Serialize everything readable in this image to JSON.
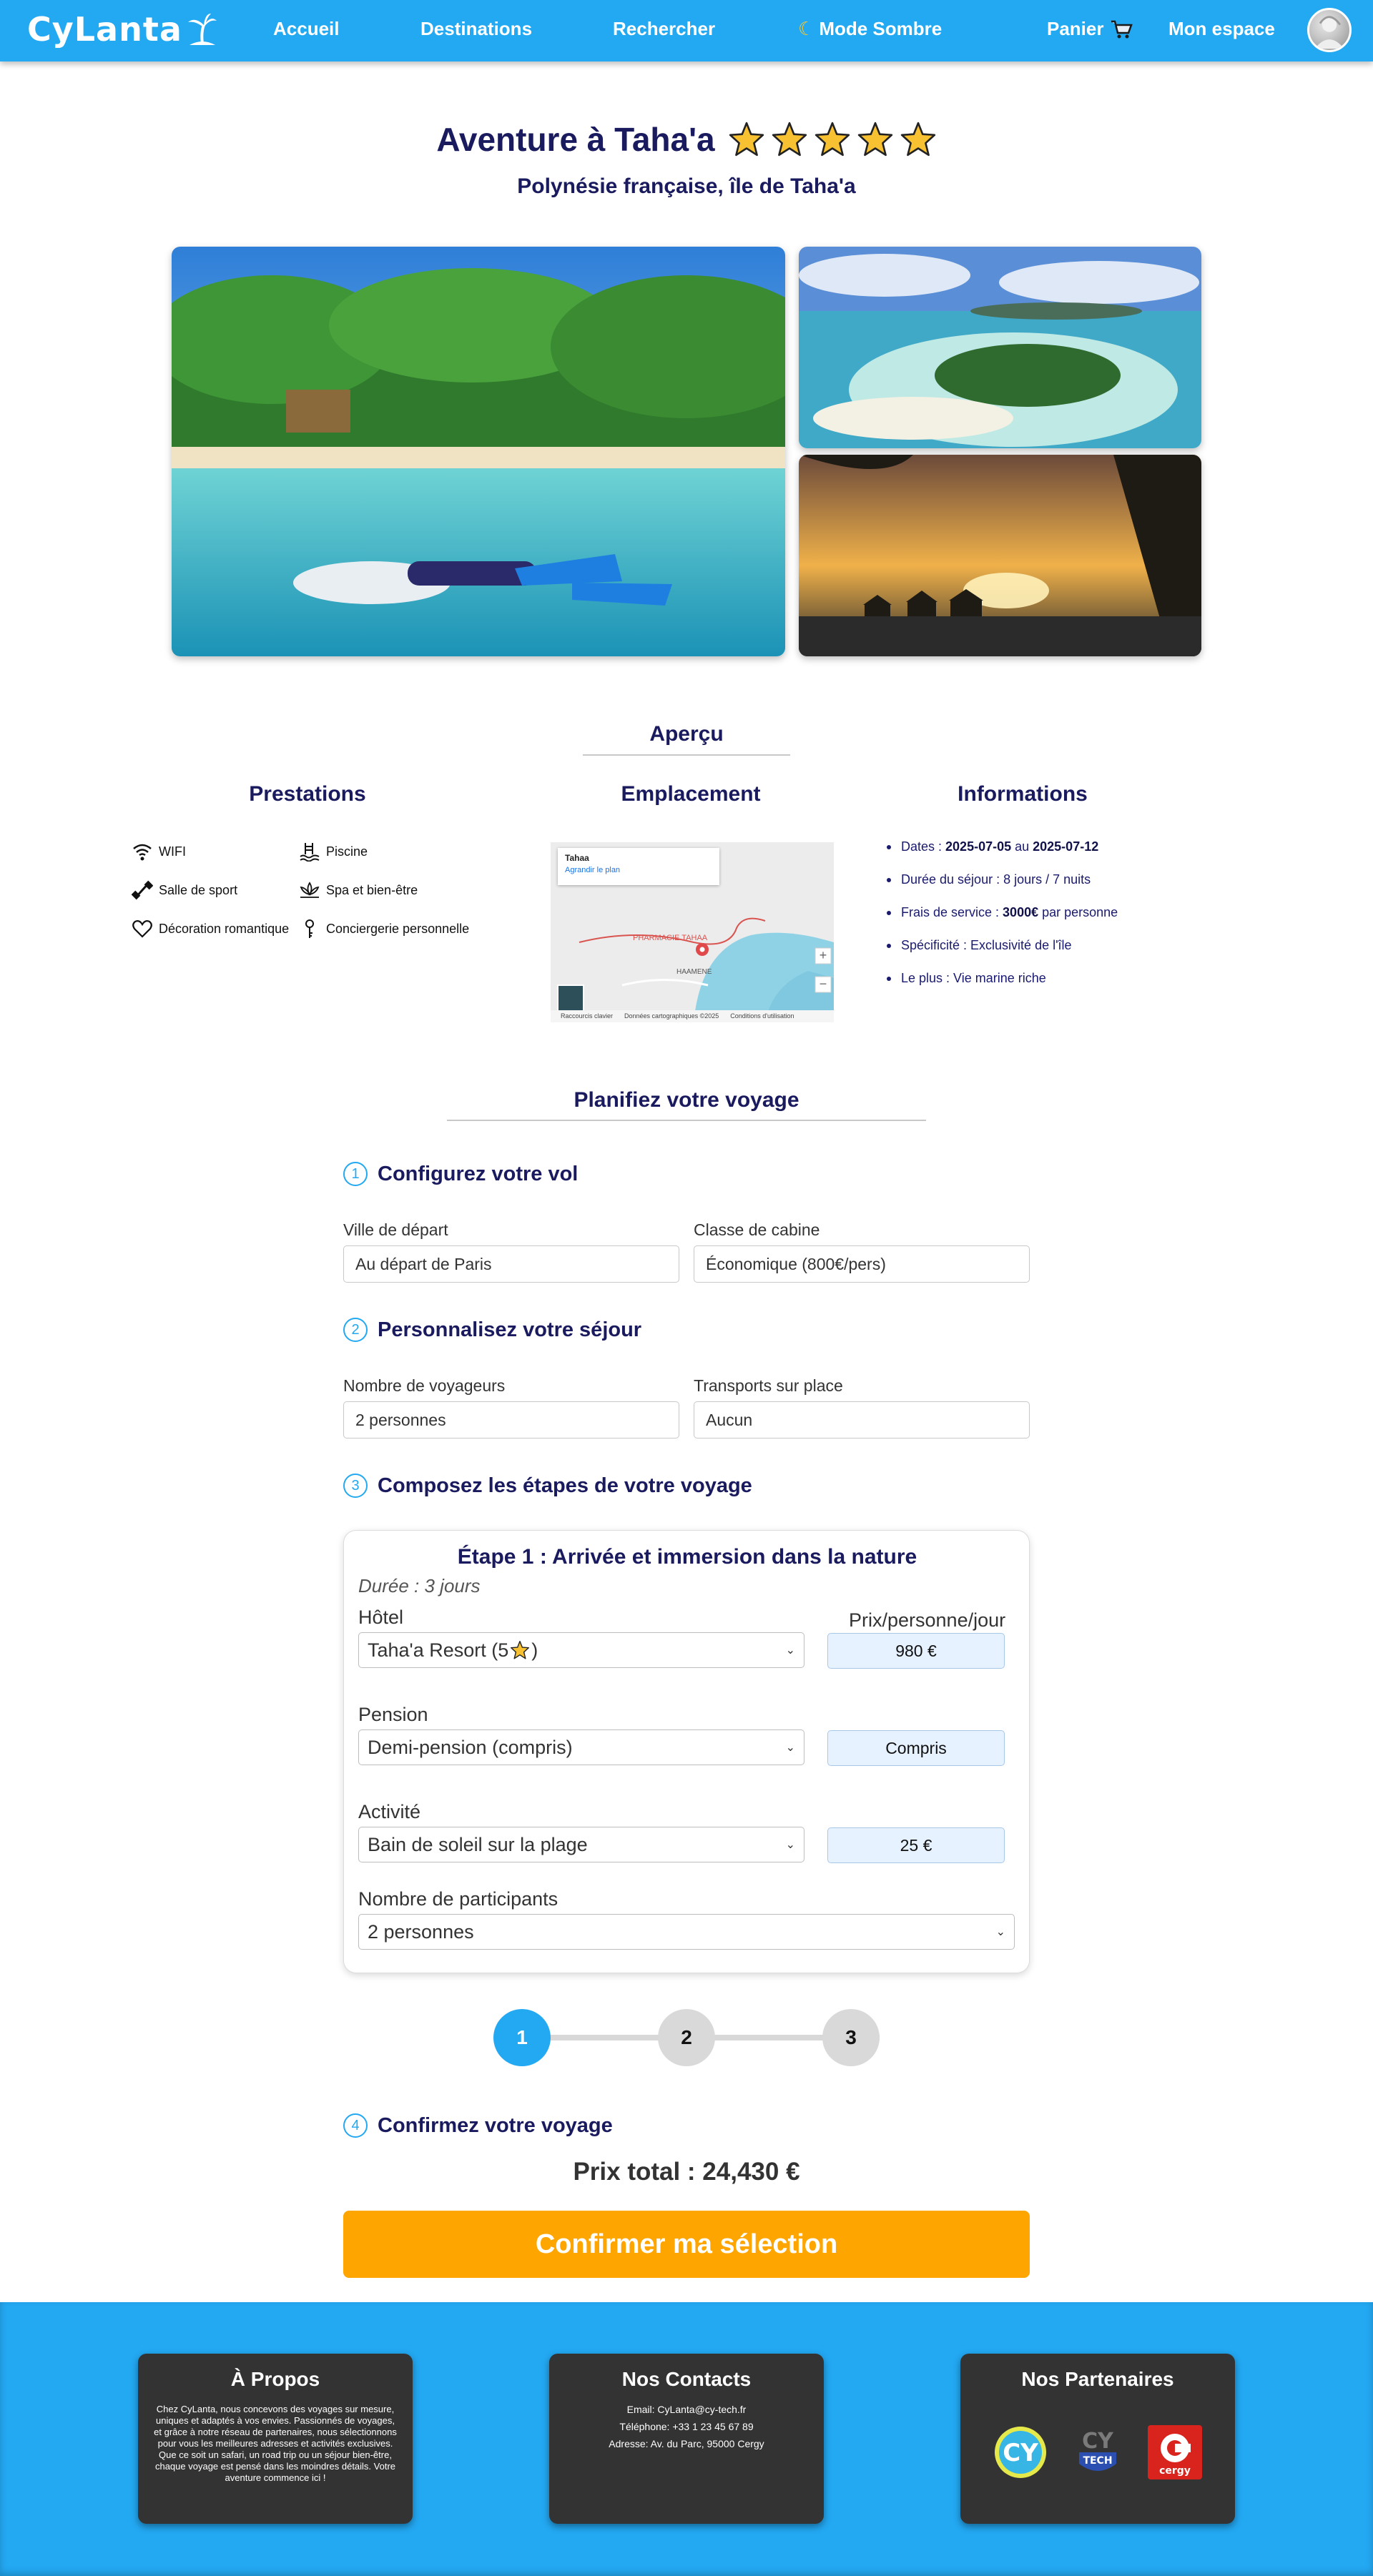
{
  "nav": {
    "brand": "CyLanta",
    "links": [
      "Accueil",
      "Destinations",
      "Rechercher"
    ],
    "dark_mode": "Mode Sombre",
    "cart": "Panier",
    "account": "Mon espace"
  },
  "hero": {
    "title": "Aventure à Taha'a",
    "rating": 5,
    "subtitle": "Polynésie française, île de Taha'a"
  },
  "overview": {
    "heading": "Aperçu",
    "prestations": {
      "heading": "Prestations",
      "items": [
        "WIFI",
        "Piscine",
        "Salle de sport",
        "Spa et bien-être",
        "Décoration romantique",
        "Conciergerie personnelle"
      ]
    },
    "emplacement": {
      "heading": "Emplacement",
      "map_place": "Tahaa",
      "map_link": "Agrandir le plan",
      "map_label1": "PHARMACIE TAHAA",
      "map_label2": "HAAMENE",
      "map_footer": [
        "Raccourcis clavier",
        "Données cartographiques ©2025",
        "Conditions d'utilisation"
      ]
    },
    "informations": {
      "heading": "Informations",
      "dates_label": "Dates : ",
      "date_start": "2025-07-05",
      "date_sep": " au ",
      "date_end": "2025-07-12",
      "duration": "Durée du séjour : 8 jours / 7 nuits",
      "fees_label": "Frais de service : ",
      "fees_value": "3000€",
      "fees_suffix": " par personne",
      "specificity": "Spécificité : Exclusivité de l'île",
      "plus": "Le plus : Vie marine riche"
    }
  },
  "plan": {
    "heading": "Planifiez votre voyage",
    "step1": {
      "num": "1",
      "title": "Configurez votre vol",
      "departure_label": "Ville de départ",
      "departure_value": "Au départ de Paris",
      "cabin_label": "Classe de cabine",
      "cabin_value": "Économique (800€/pers)"
    },
    "step2": {
      "num": "2",
      "title": "Personnalisez votre séjour",
      "travelers_label": "Nombre de voyageurs",
      "travelers_value": "2 personnes",
      "transport_label": "Transports sur place",
      "transport_value": "Aucun"
    },
    "step3": {
      "num": "3",
      "title": "Composez les étapes de votre voyage",
      "card": {
        "title": "Étape 1 : Arrivée et immersion dans la nature",
        "duration": "Durée : 3 jours",
        "hotel_label": "Hôtel",
        "price_header": "Prix/personne/jour",
        "hotel_value": "Taha'a Resort (5",
        "hotel_suffix": ")",
        "hotel_price": "980 €",
        "pension_label": "Pension",
        "pension_value": "Demi-pension (compris)",
        "pension_price": "Compris",
        "activity_label": "Activité",
        "activity_value": "Bain de soleil sur la plage",
        "activity_price": "25 €",
        "participants_label": "Nombre de participants",
        "participants_value": "2 personnes"
      },
      "stepper": [
        "1",
        "2",
        "3"
      ],
      "active_step": 1
    },
    "step4": {
      "num": "4",
      "title": "Confirmez votre voyage",
      "total": "Prix total : 24,430 €",
      "confirm": "Confirmer ma sélection"
    }
  },
  "footer": {
    "about_title": "À Propos",
    "about_text": "Chez CyLanta, nous concevons des voyages sur mesure, uniques et adaptés à vos envies. Passionnés de voyages, et grâce à notre réseau de partenaires, nous sélectionnons pour vous les meilleures adresses et activités exclusives. Que ce soit un safari, un road trip ou un séjour bien-être, chaque voyage est pensé dans les moindres détails. Votre aventure commence ici !",
    "contact_title": "Nos Contacts",
    "email": "Email: CyLanta@cy-tech.fr",
    "phone": "Téléphone: +33 1 23 45 67 89",
    "address": "Adresse: Av. du Parc, 95000 Cergy",
    "partners_title": "Nos Partenaires",
    "partners": [
      "CY",
      "CY TECH",
      "cergy"
    ]
  },
  "colors": {
    "primary": "#23a8f2",
    "navy": "#1a1a5e",
    "confirm": "#ffa500",
    "footer_card": "#333333"
  }
}
